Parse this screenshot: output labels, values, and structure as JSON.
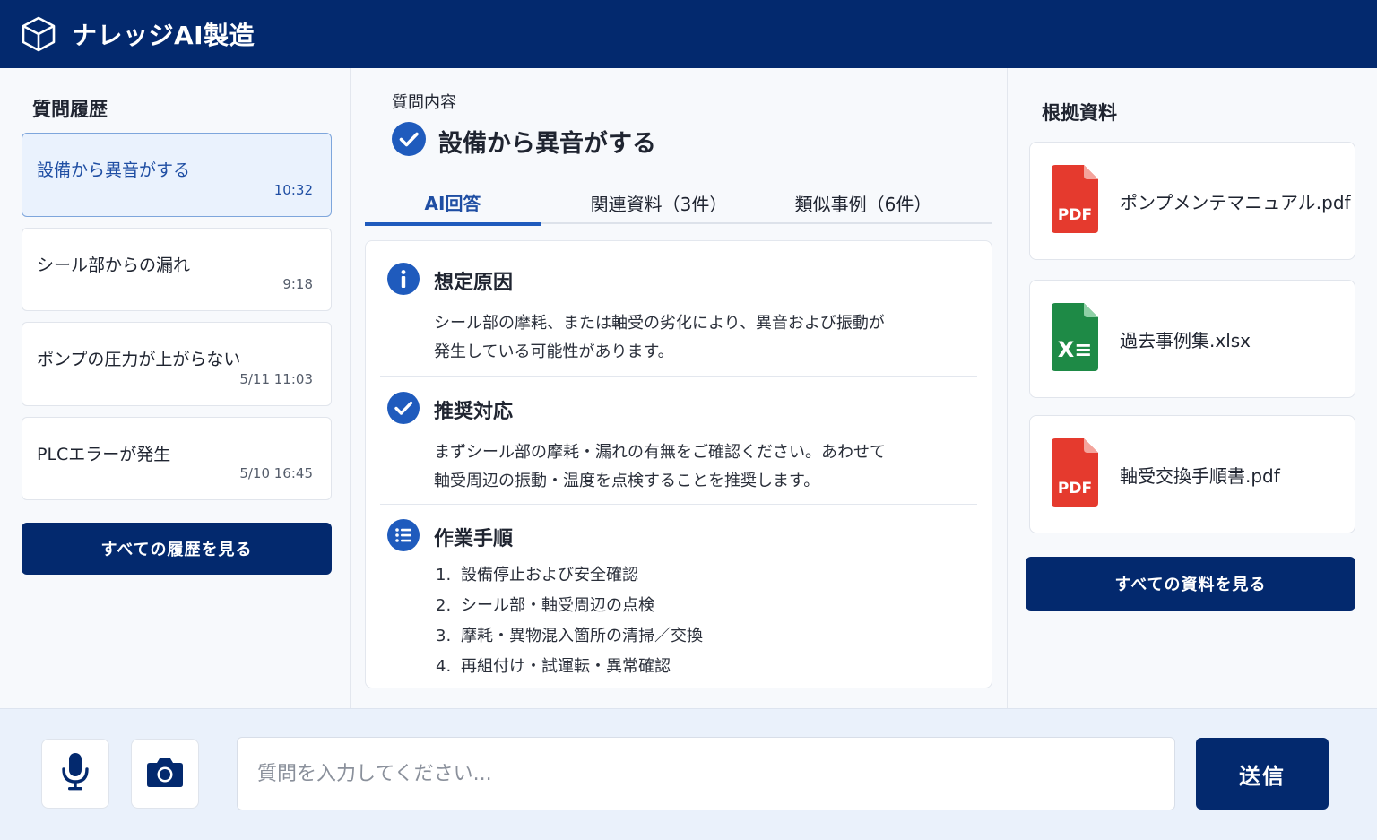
{
  "app": {
    "title": "ナレッジAI製造"
  },
  "history": {
    "title": "質問履歴",
    "items": [
      {
        "question": "設備から異音がする",
        "time": "10:32",
        "active": true
      },
      {
        "question": "シール部からの漏れ",
        "time": "9:18"
      },
      {
        "question": "ポンプの圧力が上がらない",
        "time": "5/11  11:03"
      },
      {
        "question": "PLCエラーが発生",
        "time": "5/10  16:45"
      }
    ],
    "view_all": "すべての履歴を見る"
  },
  "main": {
    "question_label": "質問内容",
    "question": "設備から異音がする",
    "tabs": [
      {
        "label": "AI回答",
        "active": true
      },
      {
        "label": "関連資料（3件）"
      },
      {
        "label": "類似事例（6件）"
      }
    ],
    "sections": {
      "cause": {
        "heading": "想定原因",
        "line1": "シール部の摩耗、または軸受の劣化により、異音および振動が",
        "line2": "発生している可能性があります。"
      },
      "action": {
        "heading": "推奨対応",
        "line1": "まずシール部の摩耗・漏れの有無をご確認ください。あわせて",
        "line2": "軸受周辺の振動・温度を点検することを推奨します。"
      },
      "steps": {
        "heading": "作業手順",
        "items": [
          {
            "num": "1.",
            "text": "設備停止および安全確認"
          },
          {
            "num": "2.",
            "text": "シール部・軸受周辺の点検"
          },
          {
            "num": "3.",
            "text": "摩耗・異物混入箇所の清掃／交換"
          },
          {
            "num": "4.",
            "text": "再組付け・試運転・異常確認"
          }
        ]
      }
    }
  },
  "sources": {
    "title": "根拠資料",
    "docs": [
      {
        "name": "ポンプメンテマニュアル.pdf",
        "type": "PDF",
        "icon": "pdf-file-icon"
      },
      {
        "name": "過去事例集.xlsx",
        "type": "X≡",
        "icon": "excel-file-icon"
      },
      {
        "name": "軸受交換手順書.pdf",
        "type": "PDF",
        "icon": "pdf-file-icon"
      }
    ],
    "view_all": "すべての資料を見る"
  },
  "composer": {
    "placeholder": "質問を入力してください...",
    "send": "送信"
  },
  "colors": {
    "brand": "#03296e",
    "accent": "#1f5bbd",
    "pdf": "#e53a2e",
    "excel": "#1e8a46"
  }
}
